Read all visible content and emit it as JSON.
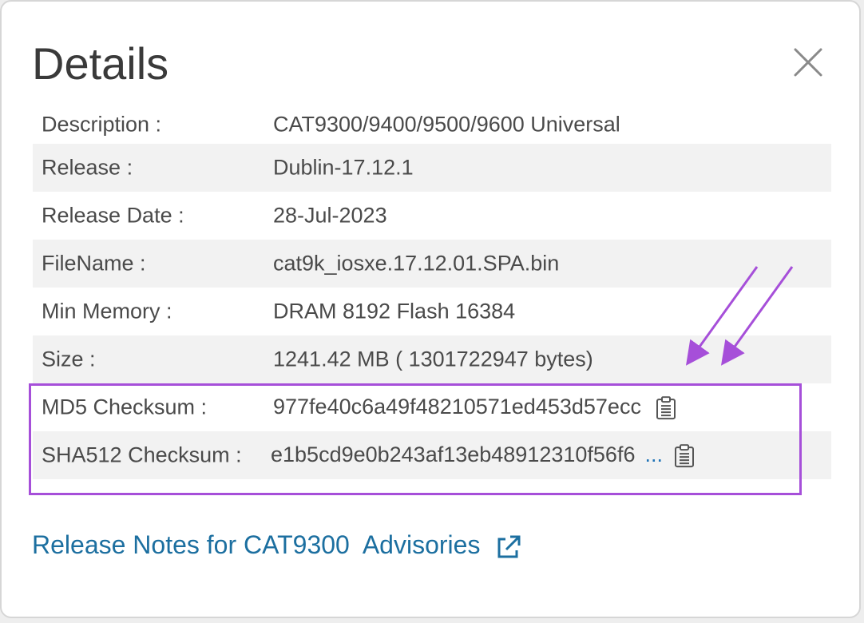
{
  "dialog": {
    "title": "Details"
  },
  "details": [
    {
      "label": "Description :",
      "value": "CAT9300/9400/9500/9600 Universal"
    },
    {
      "label": "Release :",
      "value": "Dublin-17.12.1"
    },
    {
      "label": "Release Date :",
      "value": "28-Jul-2023"
    },
    {
      "label": "FileName :",
      "value": "cat9k_iosxe.17.12.01.SPA.bin"
    },
    {
      "label": "Min Memory :",
      "value": "DRAM 8192 Flash 16384"
    },
    {
      "label": "Size :",
      "value": "1241.42 MB ( 1301722947 bytes)"
    },
    {
      "label": "MD5 Checksum :",
      "value": "977fe40c6a49f48210571ed453d57ecc"
    },
    {
      "label": "SHA512 Checksum :",
      "value": "e1b5cd9e0b243af13eb48912310f56f6",
      "more": "..."
    }
  ],
  "links": {
    "release_notes": "Release Notes for CAT9300",
    "advisories": "Advisories"
  },
  "icons": {
    "close": "close-icon",
    "copy": "clipboard-icon",
    "external": "external-link-icon"
  },
  "colors": {
    "highlight": "#a64fd9",
    "link": "#1c6fa0",
    "row_shade": "#f2f2f2"
  }
}
